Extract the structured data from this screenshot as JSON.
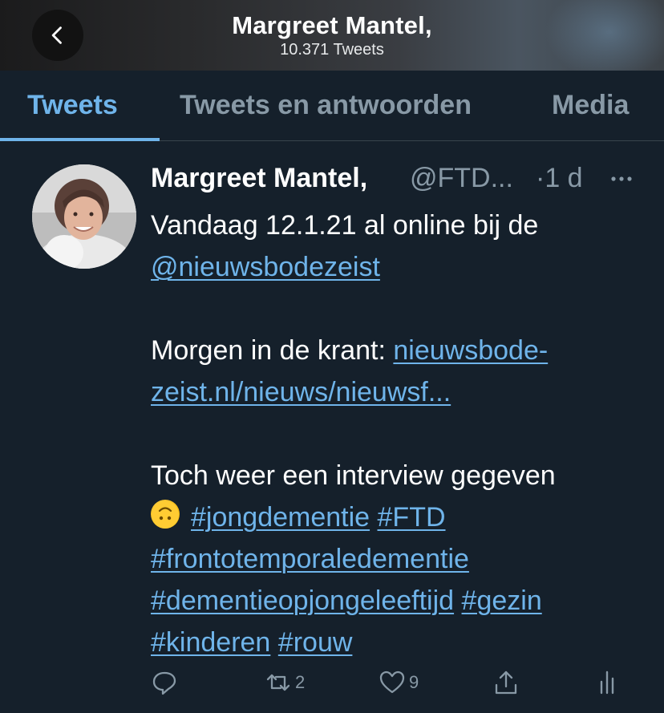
{
  "header": {
    "title": "Margreet Mantel,",
    "subtitle": "10.371 Tweets"
  },
  "tabs": [
    {
      "label": "Tweets",
      "active": true
    },
    {
      "label": "Tweets en antwoorden",
      "active": false
    },
    {
      "label": "Media",
      "active": false
    }
  ],
  "tweet": {
    "author_name": "Margreet Mantel,",
    "handle": "@FTD...",
    "time": "·1 d",
    "line1": "Vandaag 12.1.21 al online bij de",
    "mention": "@nieuwsbodezeist",
    "line3_prefix": "Morgen in de krant: ",
    "link_part1": "nieuwsbode-",
    "link_part2": "zeist.nl/nieuws/nieuwsf...",
    "line5": "Toch weer een interview gegeven",
    "hashtag_jongdementie": "#jongdementie",
    "hashtag_ftd": "#FTD",
    "hashtag_frontotemporaledementie": "#frontotemporaledementie",
    "hashtag_dementieopjongeleeftijd": "#dementieopjongeleeftijd",
    "hashtag_gezin": "#gezin",
    "hashtag_kinderen": "#kinderen",
    "hashtag_rouw": "#rouw",
    "retweet_count": "2",
    "like_count": "9"
  },
  "icons": {
    "back": "chevron-left-icon",
    "more": "more-dots-icon",
    "reply": "reply-bubble-icon",
    "retweet": "retweet-icon",
    "like": "heart-icon",
    "share": "share-icon",
    "analytics": "analytics-bars-icon",
    "emoji": "upside-down-face-emoji"
  },
  "colors": {
    "background": "#15202b",
    "link": "#6fb4ea",
    "muted": "#8899a6",
    "divider": "#38444d"
  }
}
